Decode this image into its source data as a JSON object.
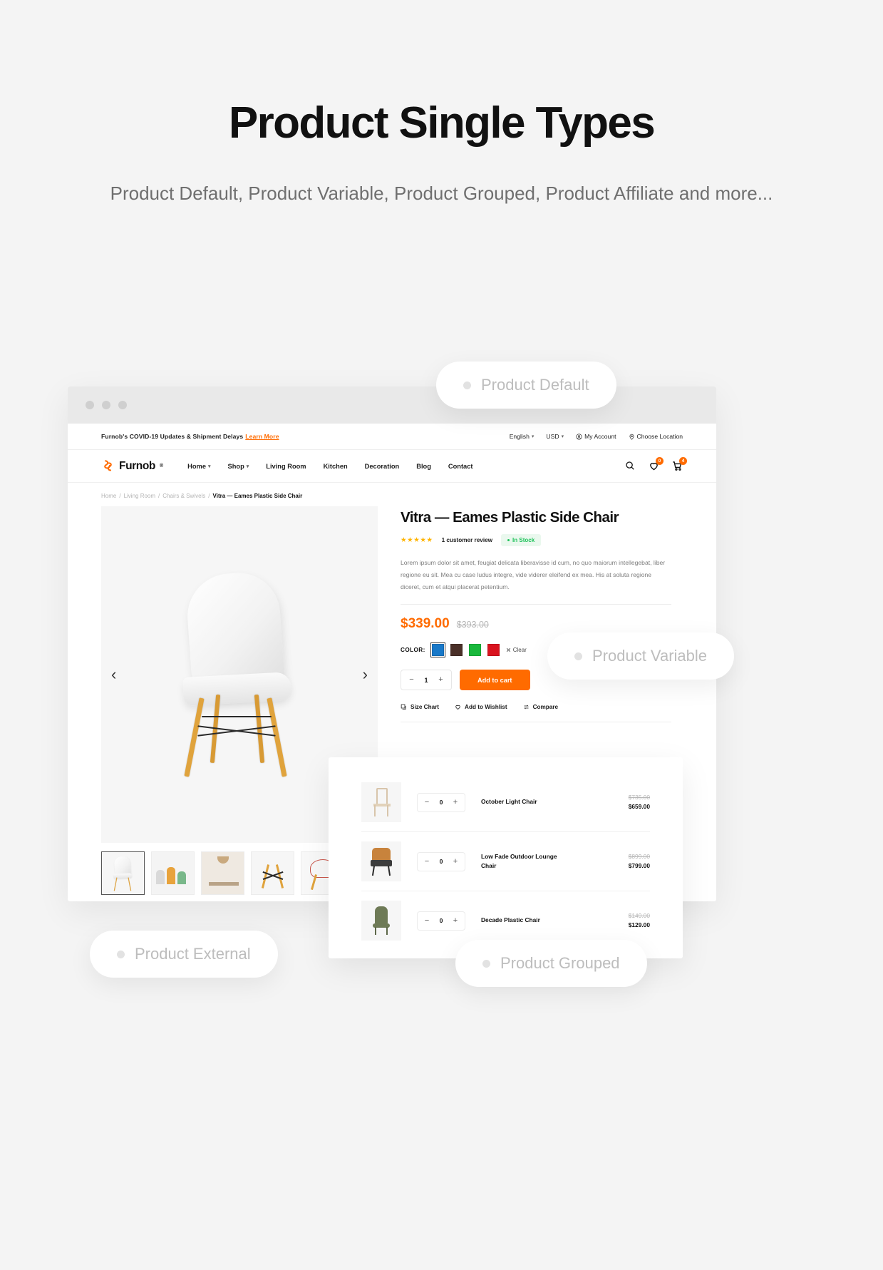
{
  "hero": {
    "title": "Product Single Types",
    "subtitle": "Product Default, Product Variable, Product Grouped, Product Affiliate and more..."
  },
  "pills": [
    {
      "id": "default",
      "label": "Product Default"
    },
    {
      "id": "variable",
      "label": "Product Variable"
    },
    {
      "id": "external",
      "label": "Product External"
    },
    {
      "id": "grouped",
      "label": "Product Grouped"
    }
  ],
  "topbar": {
    "notice": "Furnob's COVID-19 Updates & Shipment Delays",
    "learn_more": "Learn More",
    "language": "English",
    "currency": "USD",
    "account": "My Account",
    "location": "Choose Location"
  },
  "brand": {
    "name": "Furnob",
    "registered": "®"
  },
  "menu": [
    {
      "label": "Home",
      "has_dropdown": true
    },
    {
      "label": "Shop",
      "has_dropdown": true
    },
    {
      "label": "Living Room",
      "has_dropdown": false
    },
    {
      "label": "Kitchen",
      "has_dropdown": false
    },
    {
      "label": "Decoration",
      "has_dropdown": false
    },
    {
      "label": "Blog",
      "has_dropdown": false
    },
    {
      "label": "Contact",
      "has_dropdown": false
    }
  ],
  "nav_icons": {
    "search": "search-icon",
    "wishlist_count": "0",
    "cart_count": "4"
  },
  "breadcrumb": {
    "items": [
      "Home",
      "Living Room",
      "Chairs & Swivels"
    ],
    "current": "Vitra — Eames Plastic Side Chair",
    "separator": "/"
  },
  "product": {
    "title": "Vitra — Eames Plastic Side Chair",
    "stars": "★★★★★",
    "review_count": "1 customer review",
    "stock": "In Stock",
    "description": "Lorem ipsum dolor sit amet, feugiat delicata liberavisse id cum, no quo maiorum intellegebat, liber regione eu sit. Mea cu case ludus integre, vide viderer eleifend ex mea. His at soluta regione diceret, cum et atqui placerat petentium.",
    "price_new": "$339.00",
    "price_old": "$393.00",
    "color_label": "COLOR:",
    "colors": [
      {
        "name": "blue",
        "hex": "#1878c8",
        "selected": true
      },
      {
        "name": "brown",
        "hex": "#4a3028",
        "selected": false
      },
      {
        "name": "green",
        "hex": "#19b83c",
        "selected": false
      },
      {
        "name": "red",
        "hex": "#d9131f",
        "selected": false
      }
    ],
    "clear_label": "Clear",
    "quantity": "1",
    "minus": "−",
    "plus": "+",
    "add_to_cart": "Add to cart",
    "links": [
      {
        "label": "Size Chart",
        "icon": "size-chart-icon"
      },
      {
        "label": "Add to Wishlist",
        "icon": "heart-icon"
      },
      {
        "label": "Compare",
        "icon": "compare-icon"
      }
    ],
    "prev_arrow": "‹",
    "next_arrow": "›"
  },
  "grouped_products": [
    {
      "name": "October Light Chair",
      "qty": "0",
      "price_old": "$735.00",
      "price_new": "$659.00"
    },
    {
      "name": "Low Fade Outdoor Lounge Chair",
      "qty": "0",
      "price_old": "$899.00",
      "price_new": "$799.00"
    },
    {
      "name": "Decade Plastic Chair",
      "qty": "0",
      "price_old": "$149.00",
      "price_new": "$129.00"
    }
  ],
  "colors": {
    "accent": "#ff6b00",
    "stock_green": "#1ec25a",
    "star_yellow": "#ffb400",
    "page_bg": "#f4f4f4"
  }
}
